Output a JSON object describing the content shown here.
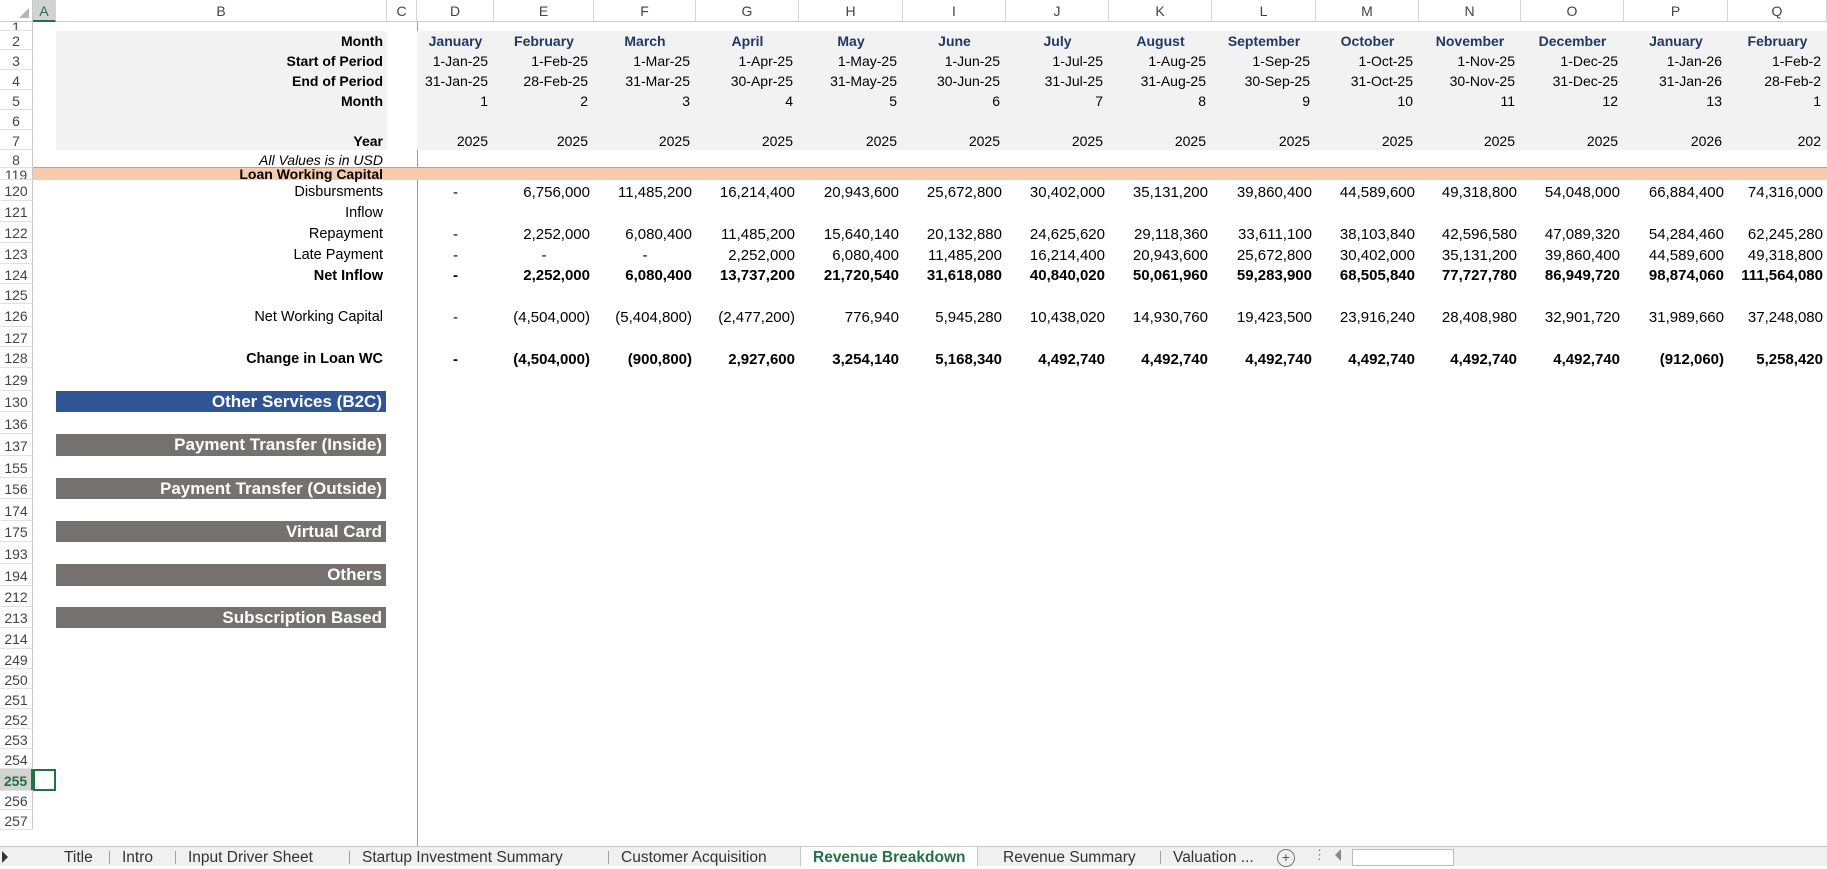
{
  "sheet": {
    "columns": [
      "A",
      "B",
      "C",
      "D",
      "E",
      "F",
      "G",
      "H",
      "I",
      "J",
      "K",
      "L",
      "M",
      "N",
      "O",
      "P",
      "Q"
    ],
    "selected_column": "A",
    "row_numbers": [
      "1",
      "2",
      "3",
      "4",
      "5",
      "6",
      "7",
      "8",
      "119",
      "120",
      "121",
      "122",
      "123",
      "124",
      "125",
      "126",
      "127",
      "128",
      "129",
      "130",
      "136",
      "137",
      "155",
      "156",
      "174",
      "175",
      "193",
      "194",
      "212",
      "213",
      "214",
      "249",
      "250",
      "251",
      "252",
      "253",
      "254",
      "255",
      "256",
      "257"
    ],
    "selected_row": "255",
    "header": {
      "labels": {
        "month": "Month",
        "start": "Start of Period",
        "end": "End of Period",
        "month_num": "Month",
        "year": "Year",
        "note": "All Values is in USD"
      },
      "months": [
        "January",
        "February",
        "March",
        "April",
        "May",
        "June",
        "July",
        "August",
        "September",
        "October",
        "November",
        "December",
        "January",
        "February"
      ],
      "starts": [
        "1-Jan-25",
        "1-Feb-25",
        "1-Mar-25",
        "1-Apr-25",
        "1-May-25",
        "1-Jun-25",
        "1-Jul-25",
        "1-Aug-25",
        "1-Sep-25",
        "1-Oct-25",
        "1-Nov-25",
        "1-Dec-25",
        "1-Jan-26",
        "1-Feb-2"
      ],
      "ends": [
        "31-Jan-25",
        "28-Feb-25",
        "31-Mar-25",
        "30-Apr-25",
        "31-May-25",
        "30-Jun-25",
        "31-Jul-25",
        "31-Aug-25",
        "30-Sep-25",
        "31-Oct-25",
        "30-Nov-25",
        "31-Dec-25",
        "31-Jan-26",
        "28-Feb-2"
      ],
      "month_nums": [
        "1",
        "2",
        "3",
        "4",
        "5",
        "6",
        "7",
        "8",
        "9",
        "10",
        "11",
        "12",
        "13",
        "1"
      ],
      "years": [
        "2025",
        "2025",
        "2025",
        "2025",
        "2025",
        "2025",
        "2025",
        "2025",
        "2025",
        "2025",
        "2025",
        "2025",
        "2026",
        "202"
      ]
    },
    "loan_wc": {
      "title": "Loan Working Capital",
      "labels": {
        "disbursements": "Disbursments",
        "inflow": "Inflow",
        "repayment": "Repayment",
        "late": "Late Payment",
        "net_inflow": "Net Inflow",
        "nwc": "Net Working Capital",
        "change": "Change in Loan WC"
      },
      "disbursements": [
        "-",
        "6,756,000",
        "11,485,200",
        "16,214,400",
        "20,943,600",
        "25,672,800",
        "30,402,000",
        "35,131,200",
        "39,860,400",
        "44,589,600",
        "49,318,800",
        "54,048,000",
        "66,884,400",
        "74,316,000"
      ],
      "repayment": [
        "-",
        "2,252,000",
        "6,080,400",
        "11,485,200",
        "15,640,140",
        "20,132,880",
        "24,625,620",
        "29,118,360",
        "33,611,100",
        "38,103,840",
        "42,596,580",
        "47,089,320",
        "54,284,460",
        "62,245,280"
      ],
      "late": [
        "-",
        "-",
        "-",
        "2,252,000",
        "6,080,400",
        "11,485,200",
        "16,214,400",
        "20,943,600",
        "25,672,800",
        "30,402,000",
        "35,131,200",
        "39,860,400",
        "44,589,600",
        "49,318,800"
      ],
      "net_inflow": [
        "-",
        "2,252,000",
        "6,080,400",
        "13,737,200",
        "21,720,540",
        "31,618,080",
        "40,840,020",
        "50,061,960",
        "59,283,900",
        "68,505,840",
        "77,727,780",
        "86,949,720",
        "98,874,060",
        "111,564,080"
      ],
      "nwc": [
        "-",
        "(4,504,000)",
        "(5,404,800)",
        "(2,477,200)",
        "776,940",
        "5,945,280",
        "10,438,020",
        "14,930,760",
        "19,423,500",
        "23,916,240",
        "28,408,980",
        "32,901,720",
        "31,989,660",
        "37,248,080"
      ],
      "change": [
        "-",
        "(4,504,000)",
        "(900,800)",
        "2,927,600",
        "3,254,140",
        "5,168,340",
        "4,492,740",
        "4,492,740",
        "4,492,740",
        "4,492,740",
        "4,492,740",
        "4,492,740",
        "(912,060)",
        "5,258,420"
      ]
    },
    "sections": [
      "Other Services (B2C)",
      "Payment Transfer (Inside)",
      "Payment Transfer (Outside)",
      "Virtual Card",
      "Others",
      "Subscription Based"
    ],
    "colors": {
      "loan_band": "#f8cbad",
      "blue_header": "#2f5597",
      "grey_header": "#767171",
      "navy_text": "#1f3864",
      "excel_green": "#217346"
    }
  },
  "tabs": {
    "items": [
      "Title",
      "Intro",
      "Input Driver Sheet",
      "Startup Investment Summary",
      "Customer Acquisition",
      "Revenue Breakdown",
      "Revenue Summary",
      "Valuation ..."
    ],
    "active": "Revenue Breakdown",
    "add_icon": "plus-circle-icon",
    "more_icon": "ellipsis-icon"
  }
}
